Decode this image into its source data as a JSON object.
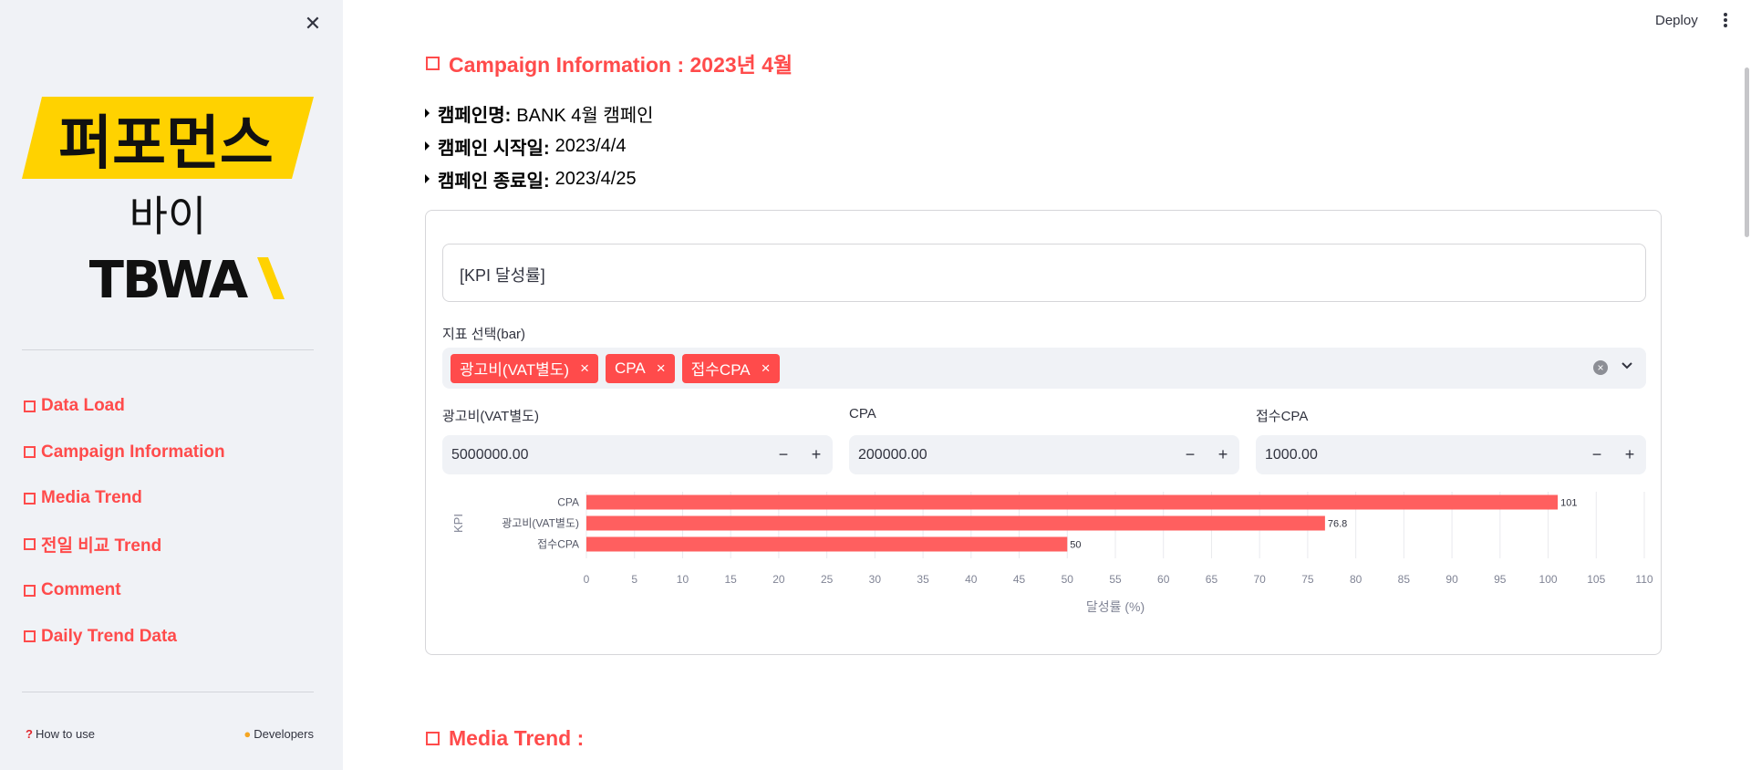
{
  "sidebar": {
    "logo": {
      "line1": "퍼포먼스",
      "line2": "바이",
      "line3": "TBWA\\"
    },
    "items": [
      {
        "label": "Data Load"
      },
      {
        "label": "Campaign Information"
      },
      {
        "label": "Media Trend"
      },
      {
        "label": "전일 비교 Trend"
      },
      {
        "label": "Comment"
      },
      {
        "label": "Daily Trend Data"
      }
    ],
    "footer": {
      "how_to_use": "How to use",
      "developers": "Developers"
    }
  },
  "header": {
    "deploy": "Deploy"
  },
  "campaign": {
    "title": "Campaign Information : 2023년 4월",
    "rows": [
      {
        "label": "캠페인명:",
        "value": "BANK 4월 캠페인"
      },
      {
        "label": "캠페인 시작일:",
        "value": "2023/4/4"
      },
      {
        "label": "캠페인 종료일:",
        "value": "2023/4/25"
      }
    ]
  },
  "kpi": {
    "header": "[KPI 달성률]",
    "select_label": "지표 선택(bar)",
    "tags": [
      "광고비(VAT별도)",
      "CPA",
      "접수CPA"
    ],
    "inputs": [
      {
        "label": "광고비(VAT별도)",
        "value": "5000000.00"
      },
      {
        "label": "CPA",
        "value": "200000.00"
      },
      {
        "label": "접수CPA",
        "value": "1000.00"
      }
    ]
  },
  "chart_data": {
    "type": "bar",
    "orientation": "horizontal",
    "categories": [
      "CPA",
      "광고비(VAT별도)",
      "접수CPA"
    ],
    "values": [
      101,
      76.8,
      50
    ],
    "value_labels": [
      "101",
      "76.8",
      "50"
    ],
    "xlabel": "달성률 (%)",
    "ylabel": "KPI",
    "xlim": [
      0,
      110
    ],
    "xticks": [
      0,
      5,
      10,
      15,
      20,
      25,
      30,
      35,
      40,
      45,
      50,
      55,
      60,
      65,
      70,
      75,
      80,
      85,
      90,
      95,
      100,
      105,
      110
    ],
    "bar_color": "#ff5f5f",
    "grid": true
  },
  "media_trend": {
    "title": "Media Trend :"
  },
  "colors": {
    "accent": "#ff4b4b",
    "sidebar_bg": "#f0f2f6",
    "logo_yellow": "#ffd200"
  }
}
